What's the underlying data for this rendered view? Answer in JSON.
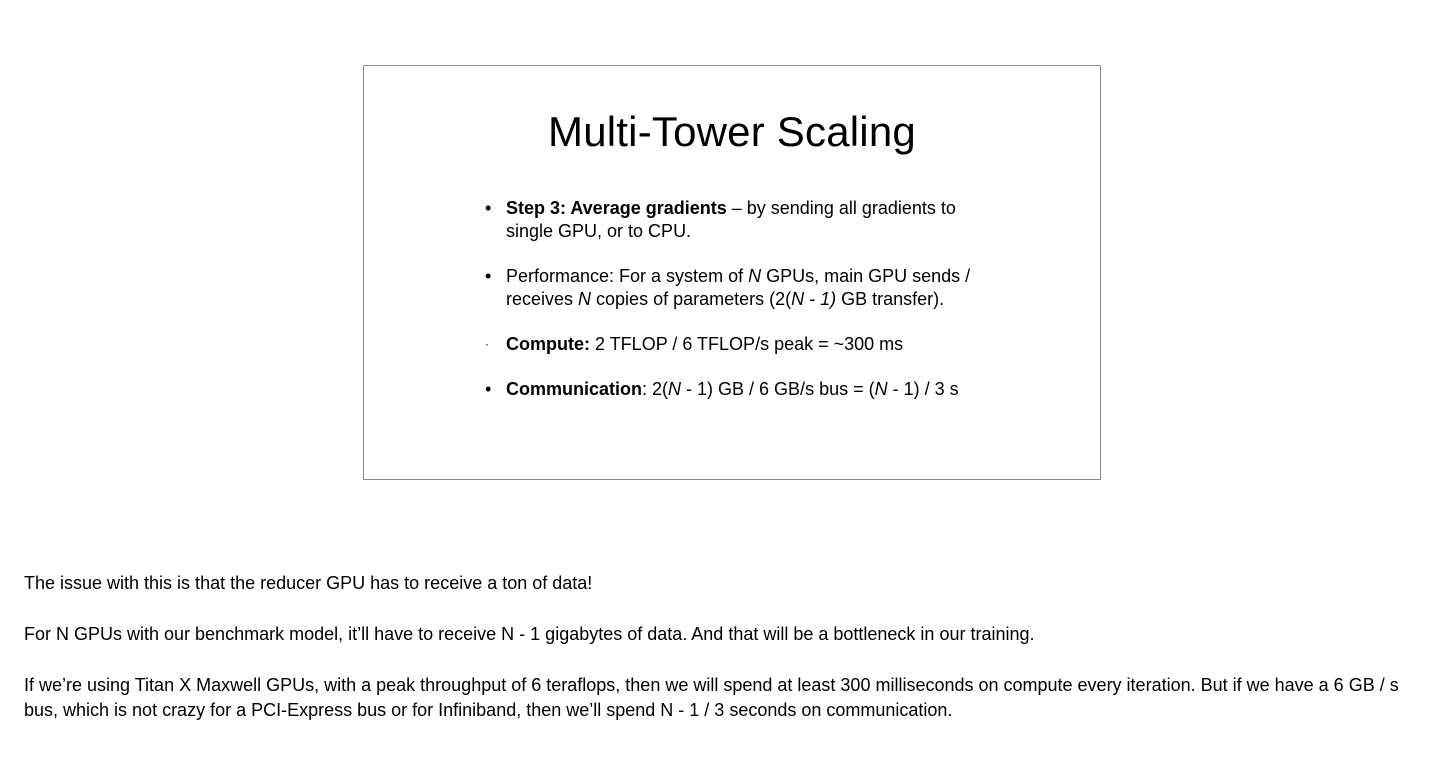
{
  "slide": {
    "title": "Multi-Tower Scaling",
    "bullet_glyph": "•",
    "bullets": [
      {
        "bold": "Step 3: Average gradients",
        "text": " – by sending all gradients to single GPU, or to CPU."
      },
      {
        "t1": "Performance: For a system of ",
        "i1": "N",
        "t2": " GPUs, main GPU sends / receives ",
        "i2": "N",
        "t3": " copies of parameters (2(",
        "i3": "N - 1)",
        "t4": " GB transfer)."
      },
      {
        "glyph": "·",
        "bold": "Compute:",
        "text": " 2 TFLOP / 6 TFLOP/s peak = ~300 ms"
      },
      {
        "bold": "Communication",
        "t1": ": 2(",
        "i1": "N",
        "t2": " - 1) GB / 6 GB/s bus = (",
        "i2": "N",
        "t3": " - 1) / 3 s"
      }
    ]
  },
  "notes": {
    "p1": "The issue with this is that the reducer GPU has to receive a ton of data!",
    "p2": "For N GPUs with our benchmark model, it’ll have to receive N - 1 gigabytes of data. And that will be a bottleneck in our training.",
    "p3": "If we’re using Titan X Maxwell GPUs, with a peak throughput of 6 teraflops, then we will spend at least 300 milliseconds on compute every iteration. But if we have a 6 GB / s bus, which is not crazy for a PCI-Express bus or for Infiniband, then we’ll spend N - 1 / 3 seconds on communication."
  }
}
